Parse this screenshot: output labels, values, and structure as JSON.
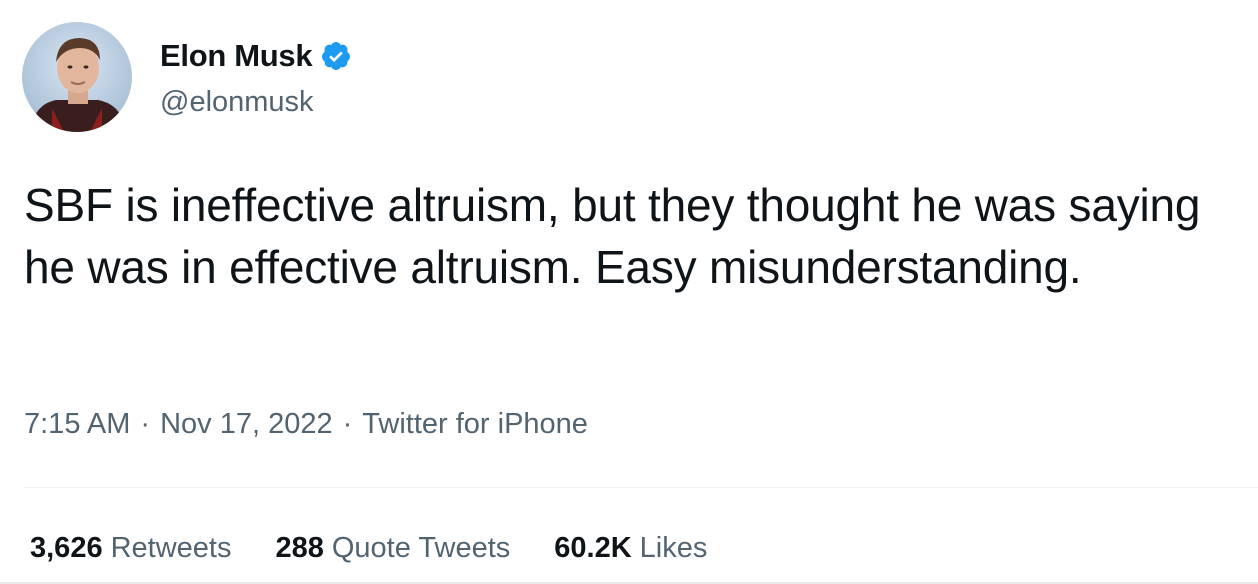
{
  "author": {
    "display_name": "Elon Musk",
    "handle": "@elonmusk",
    "verified_icon": "verified-badge-icon",
    "badge_color": "#1d9bf0"
  },
  "tweet": {
    "text": "SBF is ineffective altruism, but they thought he was saying he was in effective altruism. Easy misunderstanding.",
    "time": "7:15 AM",
    "date": "Nov 17, 2022",
    "source": "Twitter for iPhone",
    "separator": "·"
  },
  "stats": {
    "retweets_count": "3,626",
    "retweets_label": "Retweets",
    "quotes_count": "288",
    "quotes_label": "Quote Tweets",
    "likes_count": "60.2K",
    "likes_label": "Likes"
  },
  "colors": {
    "text_primary": "#0f1419",
    "text_secondary": "#536471",
    "divider": "#eff3f4"
  }
}
